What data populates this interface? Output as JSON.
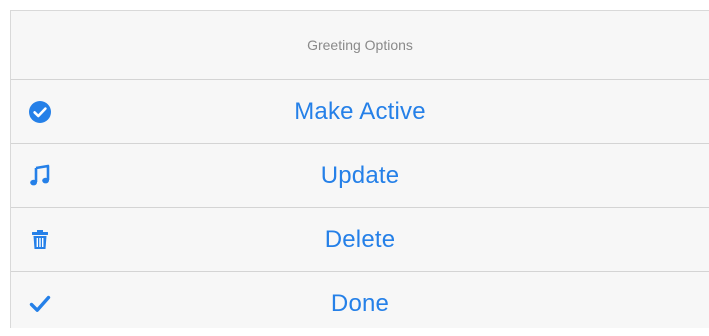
{
  "header": {
    "title": "Greeting Options"
  },
  "actions": [
    {
      "label": "Make Active",
      "icon": "check-circle-icon"
    },
    {
      "label": "Update",
      "icon": "music-note-icon"
    },
    {
      "label": "Delete",
      "icon": "trash-icon"
    },
    {
      "label": "Done",
      "icon": "checkmark-icon"
    }
  ],
  "colors": {
    "accent": "#2580e8",
    "header_text": "#8a8a8a",
    "background": "#f7f7f7",
    "divider": "#d4d4d4"
  }
}
